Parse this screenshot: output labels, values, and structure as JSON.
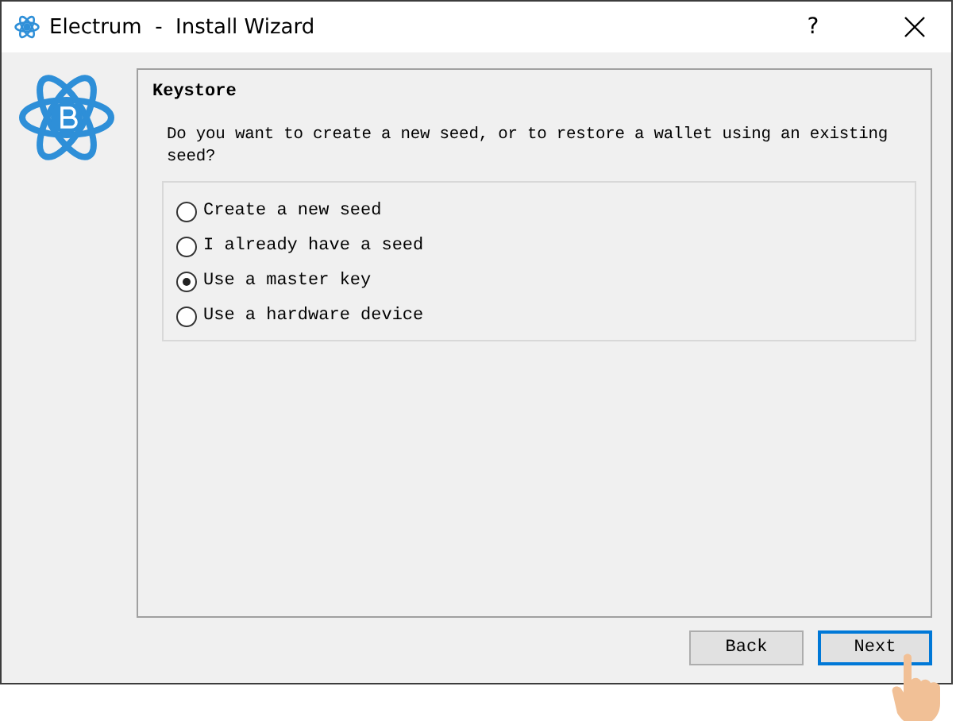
{
  "window": {
    "title": "Electrum  -  Install Wizard",
    "help": "?"
  },
  "panel": {
    "title": "Keystore",
    "question": "Do you want to create a new seed, or to restore a wallet using an existing seed?",
    "options": [
      {
        "label": "Create a new seed",
        "selected": false
      },
      {
        "label": "I already have a seed",
        "selected": false
      },
      {
        "label": "Use a master key",
        "selected": true
      },
      {
        "label": "Use a hardware device",
        "selected": false
      }
    ]
  },
  "buttons": [
    {
      "label": "Back",
      "focused": false
    },
    {
      "label": "Next",
      "focused": true
    }
  ]
}
